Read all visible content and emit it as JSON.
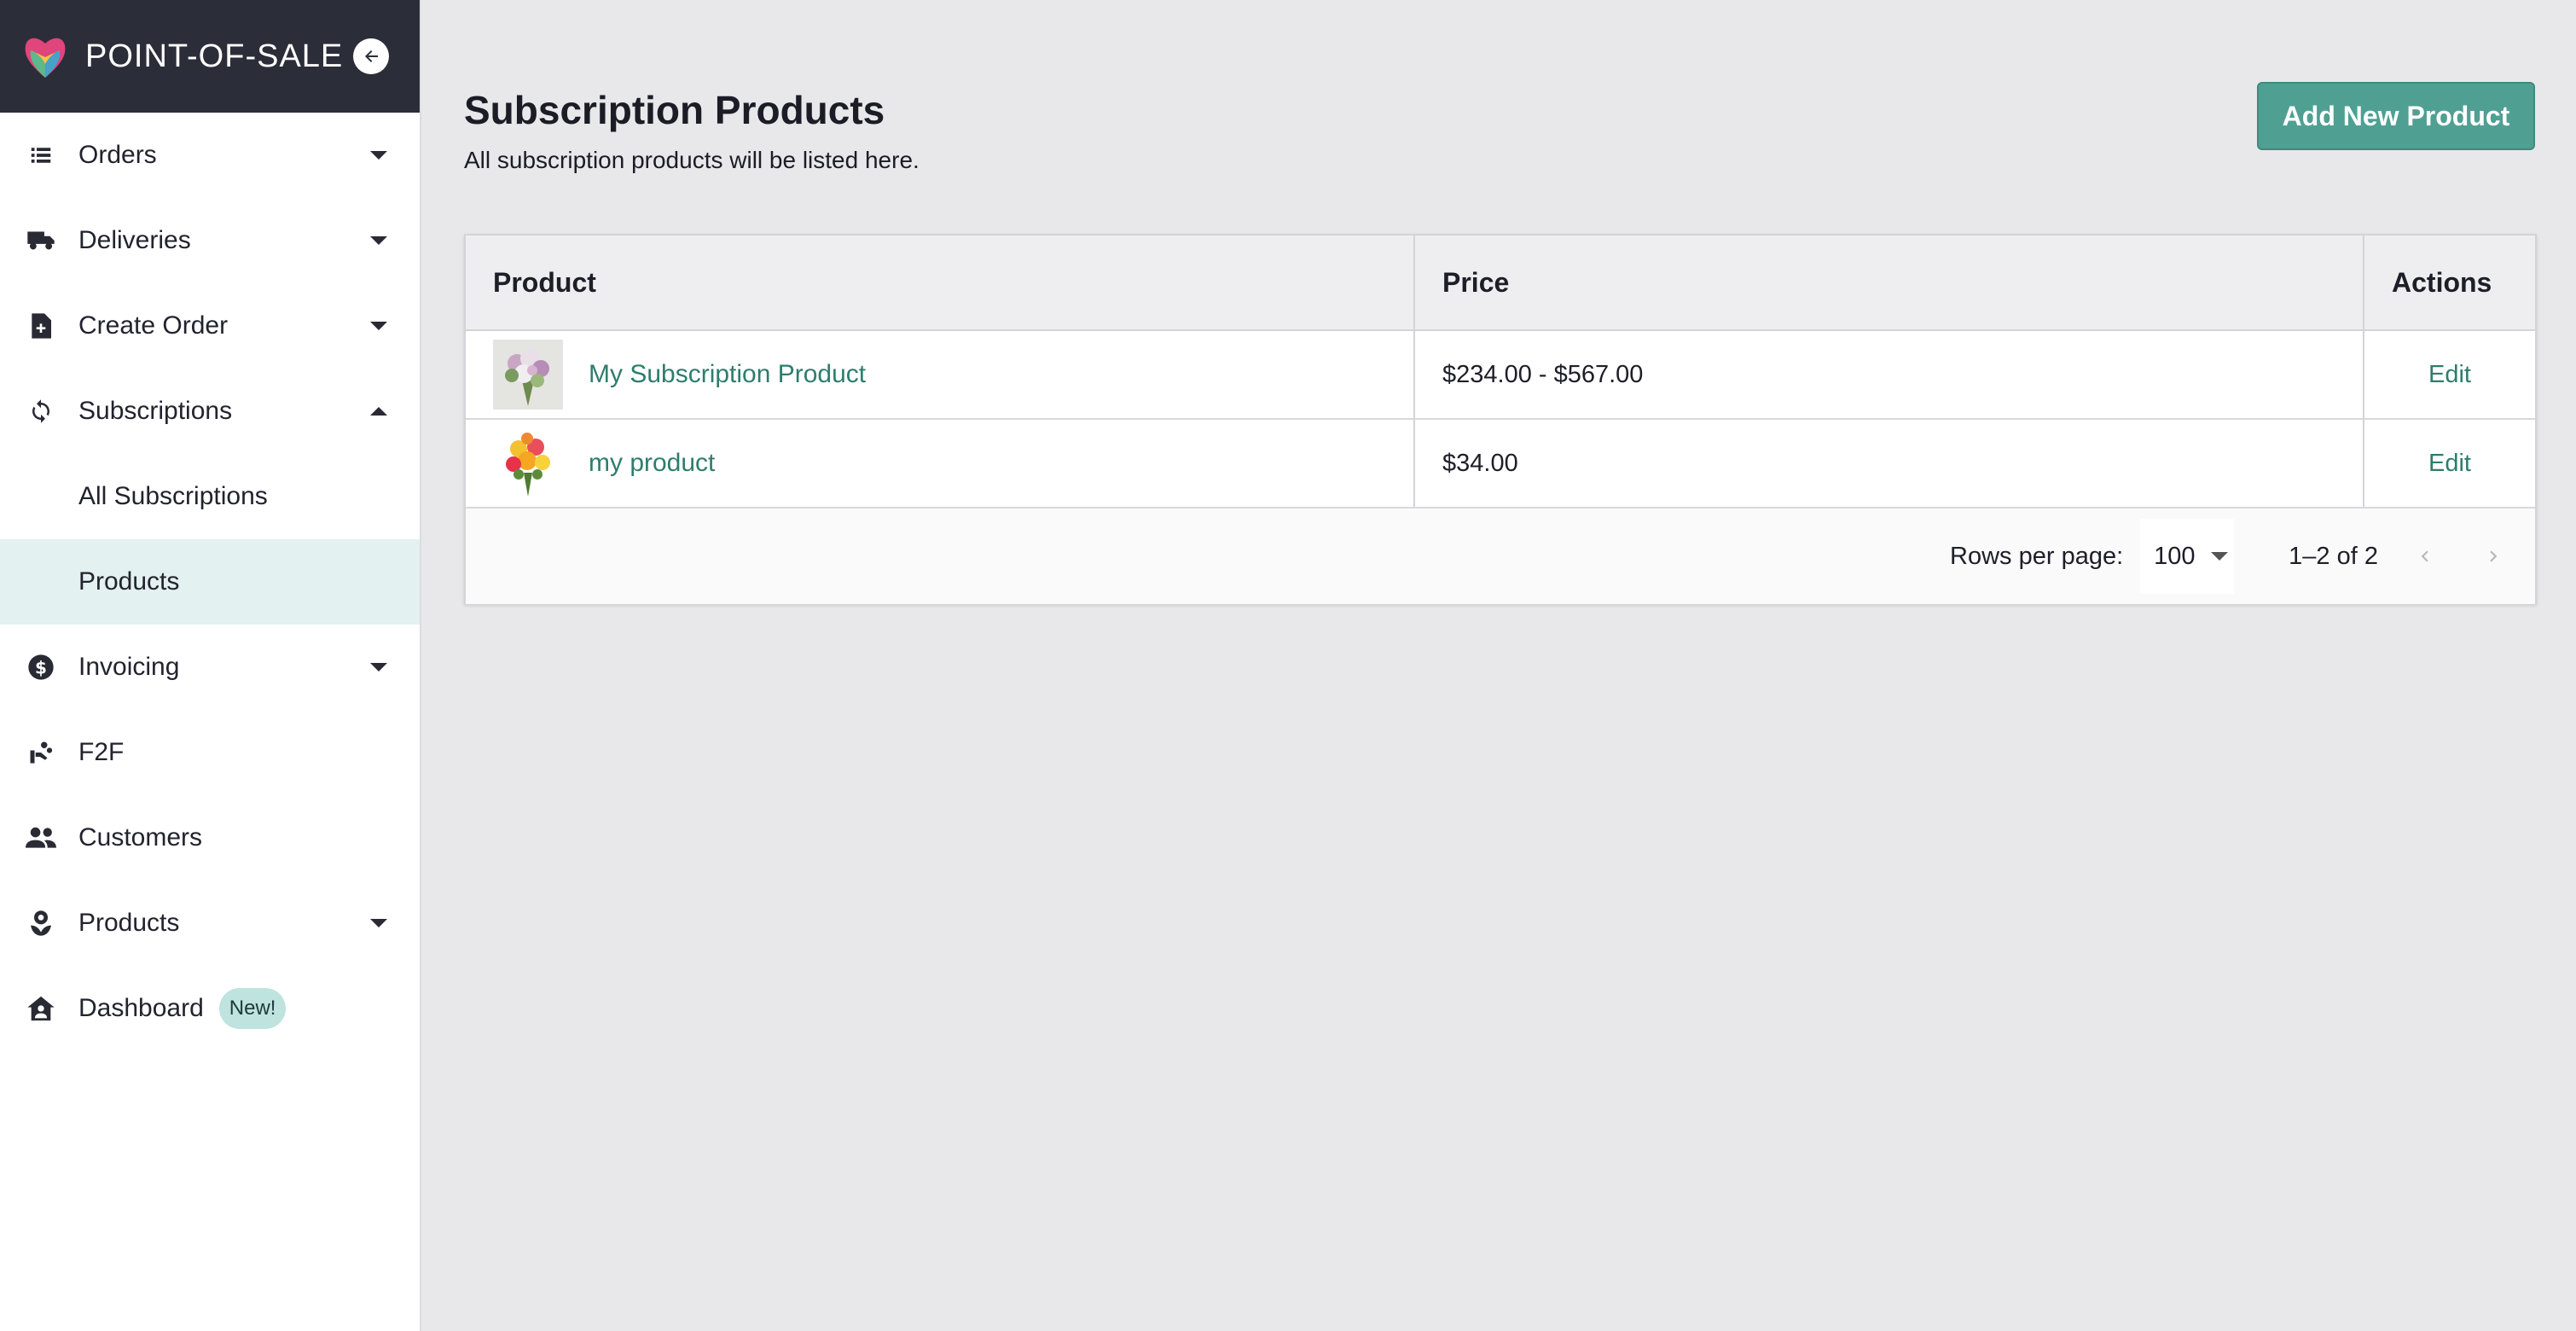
{
  "app": {
    "brand": "POINT-OF-SALE",
    "icons": {
      "logo": "heart-logo-icon",
      "collapse": "arrow-left-icon"
    }
  },
  "sidebar": {
    "items": [
      {
        "label": "Orders",
        "icon": "list-icon",
        "expand": "down"
      },
      {
        "label": "Deliveries",
        "icon": "truck-icon",
        "expand": "down"
      },
      {
        "label": "Create Order",
        "icon": "file-plus-icon",
        "expand": "down"
      },
      {
        "label": "Subscriptions",
        "icon": "sync-icon",
        "expand": "up"
      },
      {
        "label": "All Subscriptions",
        "sub": true
      },
      {
        "label": "Products",
        "sub": true,
        "active": true
      },
      {
        "label": "Invoicing",
        "icon": "dollar-circle-icon",
        "expand": "down"
      },
      {
        "label": "F2F",
        "icon": "hand-flower-icon"
      },
      {
        "label": "Customers",
        "icon": "people-icon"
      },
      {
        "label": "Products",
        "icon": "flower-icon",
        "expand": "down"
      },
      {
        "label": "Dashboard",
        "icon": "home-account-icon",
        "badge": "New!"
      }
    ]
  },
  "main": {
    "title": "Subscription Products",
    "subtitle": "All subscription products will be listed here.",
    "add_button": "Add New Product",
    "table": {
      "columns": [
        "Product",
        "Price",
        "Actions"
      ],
      "rows": [
        {
          "name": "My Subscription Product",
          "price": "$234.00 - $567.00",
          "action": "Edit",
          "thumb": "bouquet-pastel"
        },
        {
          "name": "my product",
          "price": "$34.00",
          "action": "Edit",
          "thumb": "bouquet-yellow"
        }
      ]
    },
    "pagination": {
      "rows_per_page_label": "Rows per page:",
      "rows_per_page": "100",
      "range": "1–2 of 2"
    }
  },
  "colors": {
    "accent": "#4fa093",
    "link": "#2e7d6e",
    "sidebar_header": "#2b2e38",
    "active_bg": "#e3f1f0",
    "background": "#e8e8ea"
  }
}
